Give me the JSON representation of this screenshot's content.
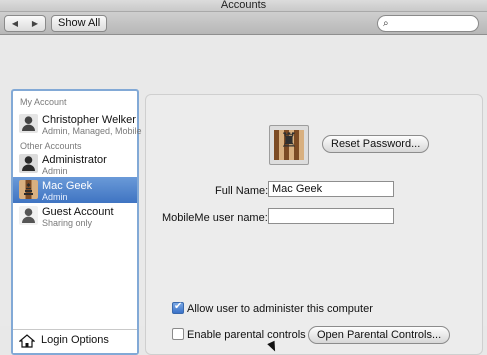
{
  "window": {
    "title": "Accounts"
  },
  "toolbar": {
    "show_all": "Show All"
  },
  "sidebar": {
    "my_account_header": "My Account",
    "other_accounts_header": "Other Accounts",
    "accounts": [
      {
        "name": "Christopher Welker",
        "subtitle": "Admin, Managed, Mobile"
      },
      {
        "name": "Administrator",
        "subtitle": "Admin"
      },
      {
        "name": "Mac Geek",
        "subtitle": "Admin"
      },
      {
        "name": "Guest Account",
        "subtitle": "Sharing only"
      }
    ],
    "login_options": "Login Options"
  },
  "main": {
    "reset_password": "Reset Password...",
    "full_name_label": "Full Name:",
    "full_name_value": "Mac Geek",
    "mobileme_label": "MobileMe user name:",
    "mobileme_value": "",
    "allow_admin_label": "Allow user to administer this computer",
    "allow_admin_checked": true,
    "parental_label": "Enable parental controls",
    "parental_checked": false,
    "open_parental": "Open Parental Controls..."
  },
  "colors": {
    "accent": "#3f74c2",
    "selection": "#4a7fcc"
  }
}
